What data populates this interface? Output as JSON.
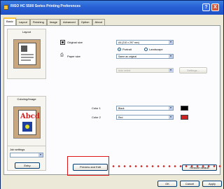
{
  "window": {
    "title": "RISO HC 5500 Series Printing Preferences",
    "help_label": "?",
    "close_label": "X"
  },
  "tabs": [
    {
      "label": "Basic"
    },
    {
      "label": "Layout"
    },
    {
      "label": "Finishing"
    },
    {
      "label": "Image"
    },
    {
      "label": "Advanced"
    },
    {
      "label": "Option"
    },
    {
      "label": "About"
    }
  ],
  "layout_group": {
    "title": "Layout"
  },
  "color_group": {
    "title": "Coloring/Image"
  },
  "job_group": {
    "title": "Job settings",
    "entry_label": "Entry"
  },
  "fields": {
    "original_size_label": "Original size",
    "original_size_value": "A4 (210 x 297 mm)",
    "portrait_label": "Portrait",
    "landscape_label": "Landscape",
    "paper_size_label": "Paper size",
    "paper_size_value": "Same as original",
    "disabled_field_value": "Auto select",
    "disabled_button_label": "Settings...",
    "color1_label": "Color 1",
    "color1_value": "Black",
    "color2_label": "Color 2",
    "color2_value": "Red",
    "color1_hex": "#000000",
    "color2_hex": "#d02020"
  },
  "preview_button": {
    "label": "Preview and Edit"
  },
  "restore_button": {
    "label": "Restore default"
  },
  "footer": {
    "ok_label": "OK",
    "cancel_label": "Cancel",
    "apply_label": "Apply"
  },
  "colors": {
    "highlight": "#e01818",
    "titlebar": "#2a63d6"
  }
}
